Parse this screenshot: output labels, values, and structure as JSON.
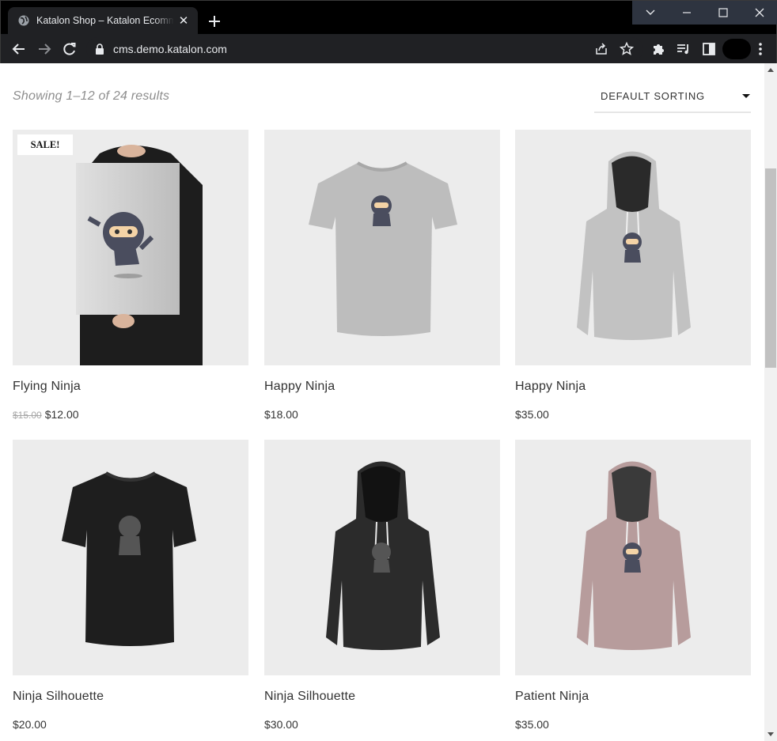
{
  "browser": {
    "tab_title": "Katalon Shop – Katalon Ecommerce",
    "url": "cms.demo.katalon.com",
    "icons": [
      "globe-icon",
      "close-icon",
      "plus-icon",
      "chevron-down-icon",
      "minimize-icon",
      "maximize-icon",
      "close-window-icon",
      "back-arrow-icon",
      "forward-arrow-icon",
      "reload-icon",
      "lock-icon",
      "share-icon",
      "star-icon",
      "puzzle-icon",
      "media-list-icon",
      "side-panel-icon",
      "more-vertical-icon"
    ]
  },
  "shop": {
    "results_text": "Showing 1–12 of 24 results",
    "sorting_label": "Default sorting",
    "sale_badge": "SALE!",
    "products": [
      {
        "name": "Flying Ninja",
        "old_price": "$15.00",
        "price": "$12.00",
        "on_sale": true,
        "image": "poster"
      },
      {
        "name": "Happy Ninja",
        "price": "$18.00",
        "image": "tshirt-grey"
      },
      {
        "name": "Happy Ninja",
        "price": "$35.00",
        "image": "hoodie-grey"
      },
      {
        "name": "Ninja Silhouette",
        "price": "$20.00",
        "image": "tshirt-black"
      },
      {
        "name": "Ninja Silhouette",
        "price": "$30.00",
        "image": "hoodie-black"
      },
      {
        "name": "Patient Ninja",
        "price": "$35.00",
        "image": "hoodie-pink"
      }
    ]
  },
  "colors": {
    "chrome_bg": "#000000",
    "toolbar_bg": "#202124",
    "thumb_bg": "#ececec",
    "text": "#333333",
    "muted": "#8e8e8e",
    "tshirt_grey": "#bdbdbd",
    "hoodie_grey": "#c2c2c2",
    "tshirt_black": "#1e1e1e",
    "hoodie_black": "#2b2b2b",
    "hoodie_pink": "#b79c9c"
  }
}
